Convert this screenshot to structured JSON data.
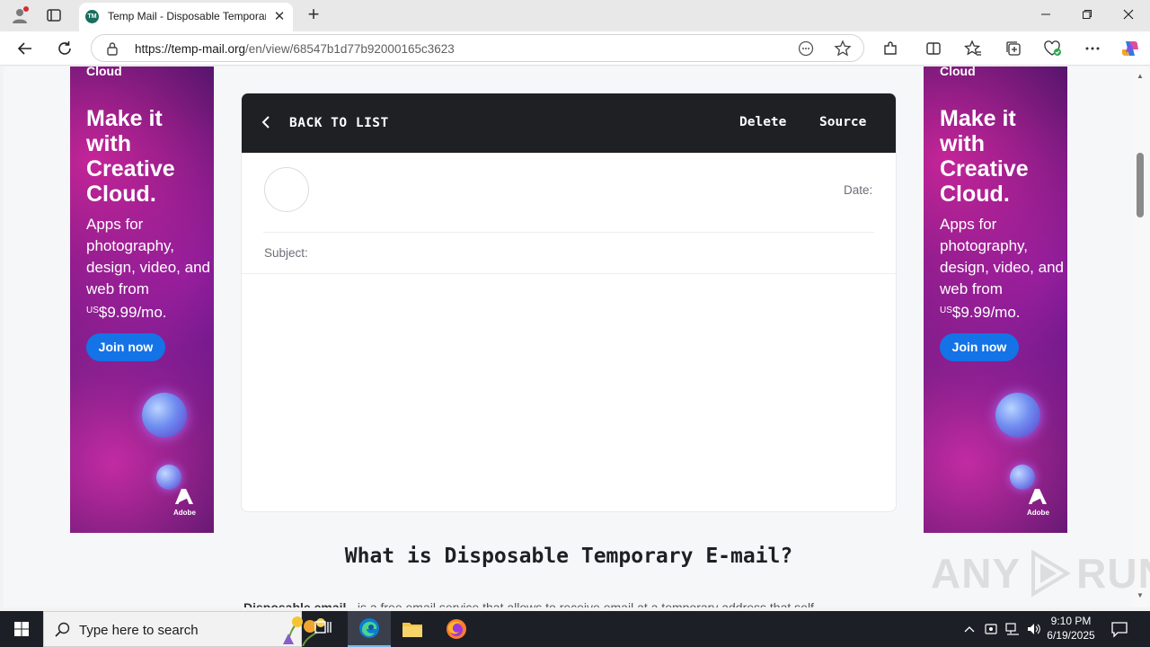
{
  "browser": {
    "tab_title": "Temp Mail - Disposable Temporar",
    "tab_favicon_text": "TM",
    "url_host": "https://temp-mail.org",
    "url_path": "/en/view/68547b1d77b92000165c3623"
  },
  "ad": {
    "brand": "Cloud",
    "headline": "Make it with Creative Cloud.",
    "body_text": "Apps for photography, design, video, and web from",
    "price_prefix": "US",
    "price": "$9.99/mo.",
    "cta": "Join now",
    "logo_text": "Adobe"
  },
  "mail": {
    "back_label": "BACK TO LIST",
    "delete_label": "Delete",
    "source_label": "Source",
    "date_label": "Date:",
    "subject_label": "Subject:"
  },
  "section": {
    "title": "What is Disposable Temporary E-mail?",
    "body_bold": "Disposable email",
    "body_rest": " - is a free email service that allows to receive email at a temporary address that self-"
  },
  "watermark": {
    "left": "ANY",
    "right": "RUN"
  },
  "taskbar": {
    "search_placeholder": "Type here to search",
    "time": "9:10 PM",
    "date": "6/19/2025"
  }
}
